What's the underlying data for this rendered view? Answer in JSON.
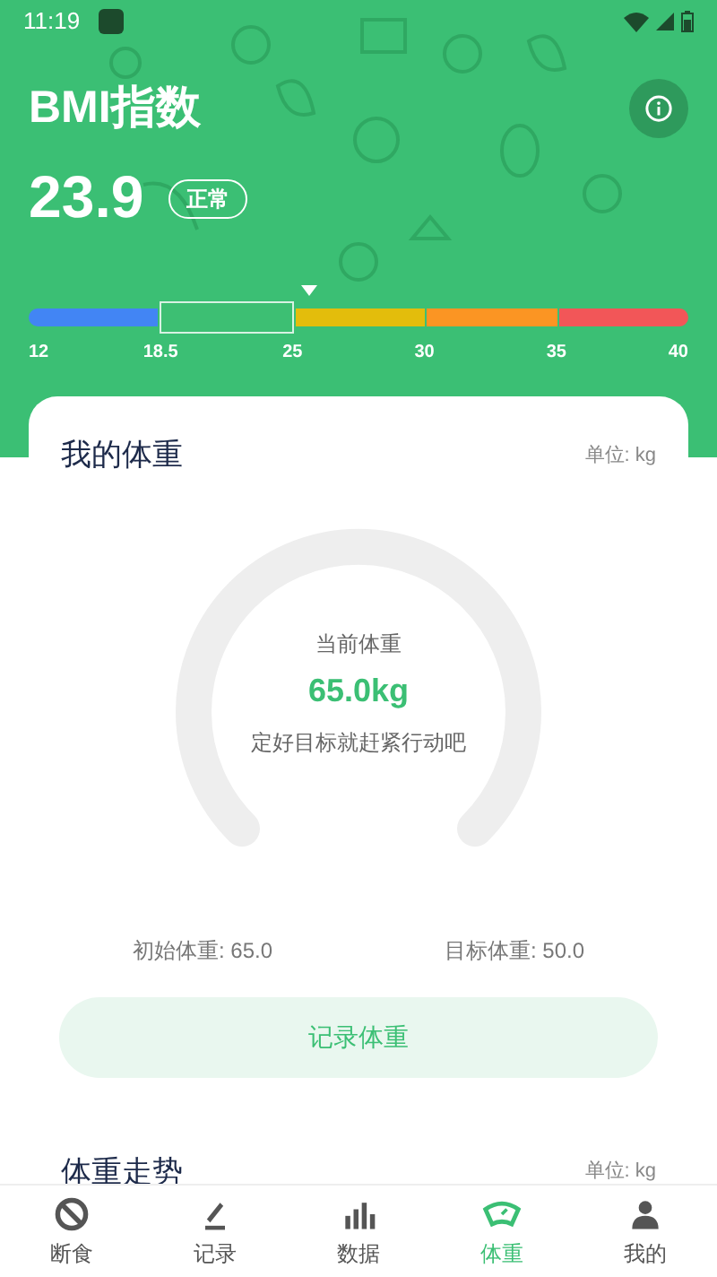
{
  "status_bar": {
    "time": "11:19"
  },
  "header": {
    "title": "BMI指数",
    "bmi": "23.9",
    "badge": "正常"
  },
  "bmi_scale": {
    "segments": [
      {
        "color": "#4285f4",
        "selected": false
      },
      {
        "color": "#3dbf73",
        "selected": true
      },
      {
        "color": "#e3bd0c",
        "selected": false
      },
      {
        "color": "#fb9523",
        "selected": false
      },
      {
        "color": "#f25658",
        "selected": false
      }
    ],
    "ticks": [
      "12",
      "18.5",
      "25",
      "30",
      "35",
      "40"
    ]
  },
  "weight_card": {
    "title": "我的体重",
    "unit": "单位: kg",
    "current_label": "当前体重",
    "current": "65.0kg",
    "hint": "定好目标就赶紧行动吧",
    "initial": "初始体重: 65.0",
    "target": "目标体重: 50.0",
    "button": "记录体重"
  },
  "trend_card": {
    "title": "体重走势",
    "unit": "单位: kg"
  },
  "nav": [
    {
      "label": "断食",
      "kind": "ban",
      "selected": false
    },
    {
      "label": "记录",
      "kind": "pencil",
      "selected": false
    },
    {
      "label": "数据",
      "kind": "chart",
      "selected": false
    },
    {
      "label": "体重",
      "kind": "scale",
      "selected": true
    },
    {
      "label": "我的",
      "kind": "person",
      "selected": false
    }
  ]
}
